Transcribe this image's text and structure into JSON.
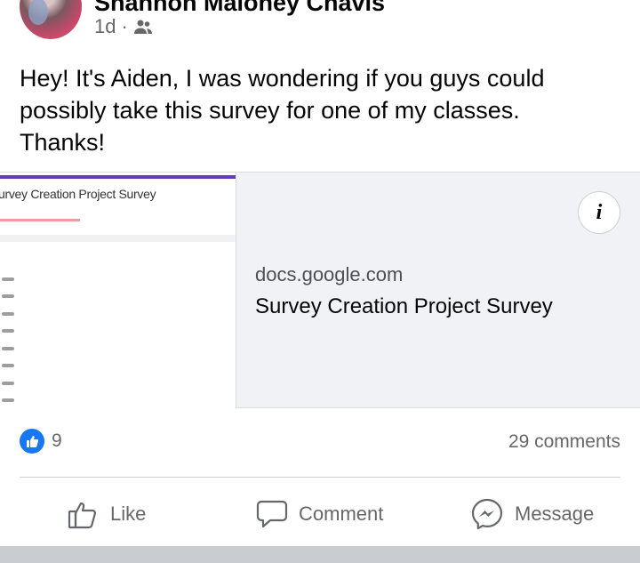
{
  "post": {
    "author": "Shannon Maloney Chavis",
    "time": "1d",
    "separator": "·",
    "audience_icon": "friends-icon",
    "text": "Hey! It's Aiden, I was wondering if you guys could possibly take this survey for one of my classes. Thanks!"
  },
  "link_preview": {
    "thumbnail_title": "urvey Creation Project Survey",
    "domain": "docs.google.com",
    "title": "Survey Creation Project Survey",
    "info_label": "i"
  },
  "stats": {
    "reaction_icon": "like-icon",
    "reaction_count": "9",
    "comments": "29 comments"
  },
  "actions": {
    "like": "Like",
    "comment": "Comment",
    "message": "Message"
  },
  "colors": {
    "brand_blue": "#1877f2",
    "secondary_text": "#65676b",
    "forms_purple": "#673ab7"
  }
}
